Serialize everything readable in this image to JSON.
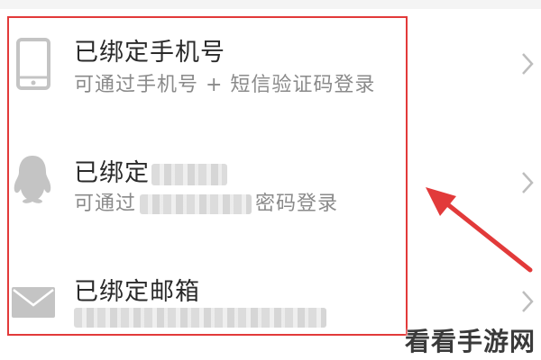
{
  "bindings": [
    {
      "icon": "phone-icon",
      "title": "已绑定手机号",
      "subtitle": "可通过手机号 + 短信验证码登录"
    },
    {
      "icon": "qq-penguin-icon",
      "title_prefix": "已绑定",
      "subtitle_prefix": "可通过",
      "subtitle_suffix": "密码登录"
    },
    {
      "icon": "mail-icon",
      "title": "已绑定邮箱"
    }
  ],
  "watermark": "看看手游网",
  "colors": {
    "highlight": "#e23a3a",
    "title_text": "#2a2a2a",
    "subtitle_text": "#8a8a8a",
    "icon_gray": "#c4c4c4",
    "chevron_gray": "#bdbdbd"
  }
}
